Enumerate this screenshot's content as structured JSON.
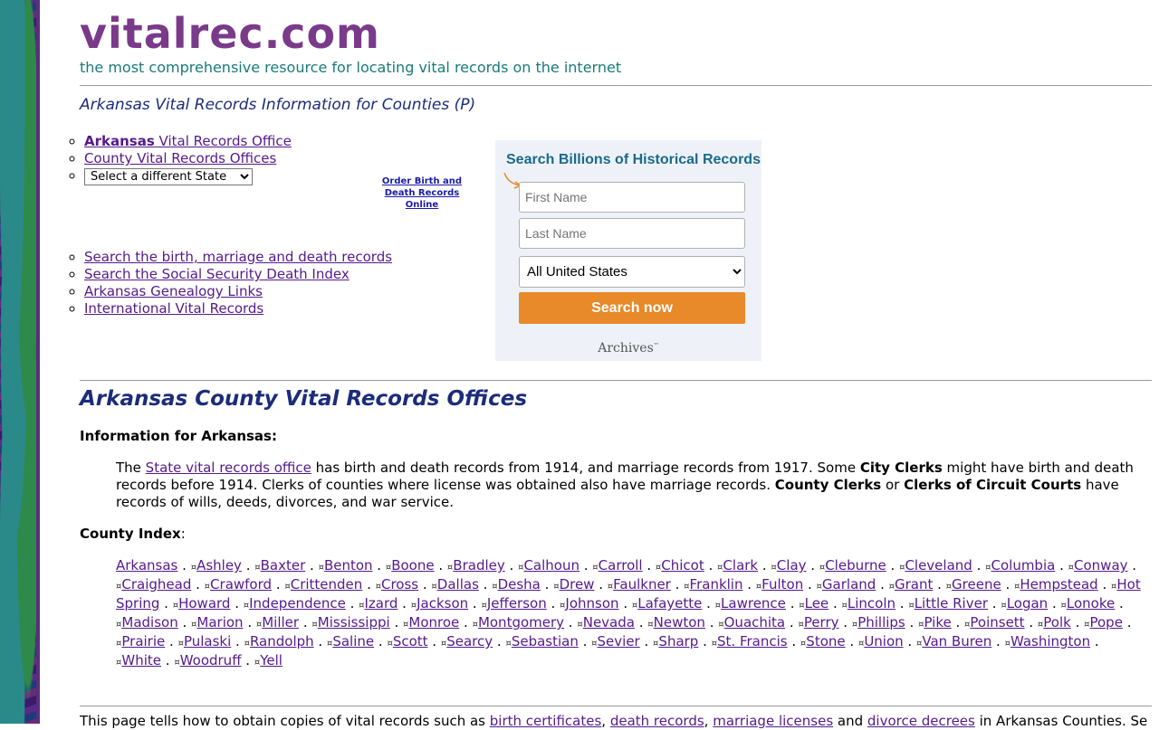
{
  "site": {
    "logo": "vitalrec.com",
    "tagline": "the most comprehensive resource for locating vital records on the internet",
    "subtitle": "Arkansas Vital Records Information for Counties (P)"
  },
  "nav": {
    "state_office_bold": "Arkansas",
    "state_office_rest": " Vital Records Office",
    "county_offices": "County Vital Records Offices",
    "state_select": "Select a different State",
    "order_line1": "Order Birth and",
    "order_line2": "Death Records Online",
    "links2": [
      "Search the birth, marriage and death records",
      "Search the Social Security Death Index",
      "Arkansas Genealogy Links",
      "International Vital Records"
    ]
  },
  "search_widget": {
    "title": "Search Billions of Historical Records",
    "first_name_placeholder": "First Name",
    "last_name_placeholder": "Last Name",
    "location_value": "All United States",
    "button": "Search now",
    "brand": "Archives",
    "brand_tm": "™",
    "colors": {
      "button": "#e8892a",
      "title": "#1a6a8a",
      "background": "#eef2f8"
    }
  },
  "main": {
    "heading": "Arkansas County Vital Records Offices",
    "info_heading": "Information for Arkansas:",
    "para": {
      "t1": "The ",
      "link": "State vital records office",
      "t2": " has birth and death records from 1914, and marriage records from 1917. Some ",
      "b1": "City Clerks",
      "t3": " might have birth and death records before 1914. Clerks of counties where license was obtained also have marriage records. ",
      "b2": "County Clerks",
      "t4": " or ",
      "b3": "Clerks of Circuit Courts",
      "t5": " have records of wills, deeds, divorces, and war service."
    },
    "county_index_label": "County Index",
    "county_index_colon": ":",
    "counties": [
      "Arkansas",
      "Ashley",
      "Baxter",
      "Benton",
      "Boone",
      "Bradley",
      "Calhoun",
      "Carroll",
      "Chicot",
      "Clark",
      "Clay",
      "Cleburne",
      "Cleveland",
      "Columbia",
      "Conway",
      "Craighead",
      "Crawford",
      "Crittenden",
      "Cross",
      "Dallas",
      "Desha",
      "Drew",
      "Faulkner",
      "Franklin",
      "Fulton",
      "Garland",
      "Grant",
      "Greene",
      "Hempstead",
      "Hot Spring",
      "Howard",
      "Independence",
      "Izard",
      "Jackson",
      "Jefferson",
      "Johnson",
      "Lafayette",
      "Lawrence",
      "Lee",
      "Lincoln",
      "Little River",
      "Logan",
      "Lonoke",
      "Madison",
      "Marion",
      "Miller",
      "Mississippi",
      "Monroe",
      "Montgomery",
      "Nevada",
      "Newton",
      "Ouachita",
      "Perry",
      "Phillips",
      "Pike",
      "Poinsett",
      "Polk",
      "Pope",
      "Prairie",
      "Pulaski",
      "Randolph",
      "Saline",
      "Scott",
      "Searcy",
      "Sebastian",
      "Sevier",
      "Sharp",
      "St. Francis",
      "Stone",
      "Union",
      "Van Buren",
      "Washington",
      "White",
      "Woodruff",
      "Yell"
    ],
    "separator": " . ",
    "marker": "¤",
    "footer": {
      "t1": "This page tells how to obtain copies of vital records such as ",
      "l1": "birth certificates",
      "s1": ", ",
      "l2": "death records",
      "s2": ", ",
      "l3": "marriage licenses",
      "s3": " and ",
      "l4": "divorce decrees",
      "t2": " in Arkansas Counties. See the"
    }
  }
}
